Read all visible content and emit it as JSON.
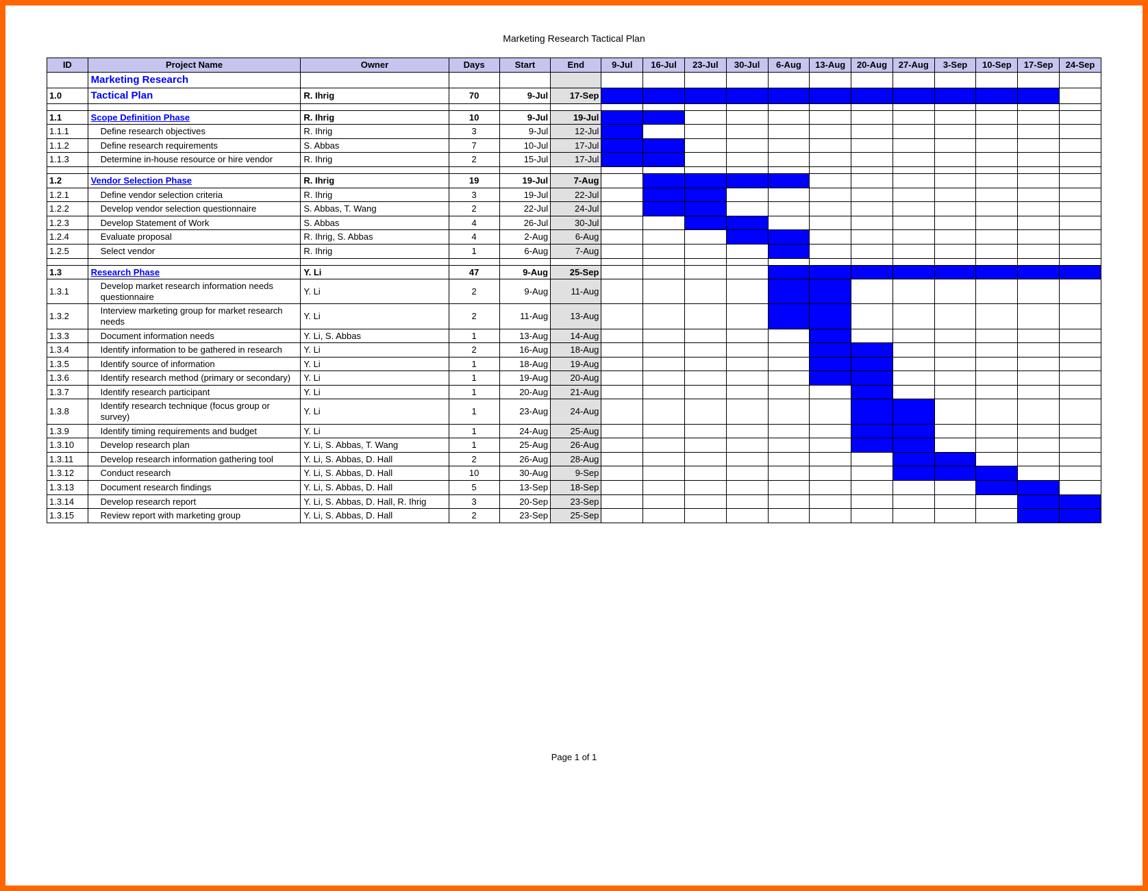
{
  "pageTitle": "Marketing Research Tactical Plan",
  "footer": "Page 1 of 1",
  "headers": {
    "id": "ID",
    "project": "Project Name",
    "owner": "Owner",
    "days": "Days",
    "start": "Start",
    "end": "End",
    "dates": [
      "9-Jul",
      "16-Jul",
      "23-Jul",
      "30-Jul",
      "6-Aug",
      "13-Aug",
      "20-Aug",
      "27-Aug",
      "3-Sep",
      "10-Sep",
      "17-Sep",
      "24-Sep"
    ]
  },
  "rows": [
    {
      "type": "title",
      "id": "",
      "project": "Marketing Research",
      "owner": "",
      "days": "",
      "start": "",
      "end": "",
      "gantt": []
    },
    {
      "type": "title",
      "id": "1.0",
      "project": "Tactical Plan",
      "owner": "R. Ihrig",
      "days": "70",
      "start": "9-Jul",
      "end": "17-Sep",
      "gantt": [
        0,
        1,
        2,
        3,
        4,
        5,
        6,
        7,
        8,
        9,
        10
      ]
    },
    {
      "type": "spacer"
    },
    {
      "type": "phase",
      "id": "1.1",
      "project": "Scope Definition Phase",
      "owner": "R. Ihrig",
      "days": "10",
      "start": "9-Jul",
      "end": "19-Jul",
      "gantt": [
        0,
        1
      ]
    },
    {
      "type": "task",
      "id": "1.1.1",
      "project": "Define research objectives",
      "owner": "R. Ihrig",
      "days": "3",
      "start": "9-Jul",
      "end": "12-Jul",
      "gantt": [
        0
      ]
    },
    {
      "type": "task",
      "id": "1.1.2",
      "project": "Define research requirements",
      "owner": "S. Abbas",
      "days": "7",
      "start": "10-Jul",
      "end": "17-Jul",
      "gantt": [
        0,
        1
      ]
    },
    {
      "type": "task",
      "id": "1.1.3",
      "project": "Determine in-house resource or hire vendor",
      "owner": "R. Ihrig",
      "days": "2",
      "start": "15-Jul",
      "end": "17-Jul",
      "gantt": [
        0,
        1
      ]
    },
    {
      "type": "spacer"
    },
    {
      "type": "phase",
      "id": "1.2",
      "project": "Vendor Selection Phase",
      "owner": "R. Ihrig",
      "days": "19",
      "start": "19-Jul",
      "end": "7-Aug",
      "gantt": [
        1,
        2,
        3,
        4
      ]
    },
    {
      "type": "task",
      "id": "1.2.1",
      "project": "Define vendor selection criteria",
      "owner": "R. Ihrig",
      "days": "3",
      "start": "19-Jul",
      "end": "22-Jul",
      "gantt": [
        1,
        2
      ]
    },
    {
      "type": "task",
      "id": "1.2.2",
      "project": "Develop vendor selection questionnaire",
      "owner": "S. Abbas, T. Wang",
      "days": "2",
      "start": "22-Jul",
      "end": "24-Jul",
      "gantt": [
        1,
        2
      ]
    },
    {
      "type": "task",
      "id": "1.2.3",
      "project": "Develop Statement of Work",
      "owner": "S. Abbas",
      "days": "4",
      "start": "26-Jul",
      "end": "30-Jul",
      "gantt": [
        2,
        3
      ]
    },
    {
      "type": "task",
      "id": "1.2.4",
      "project": "Evaluate proposal",
      "owner": "R. Ihrig, S. Abbas",
      "days": "4",
      "start": "2-Aug",
      "end": "6-Aug",
      "gantt": [
        3,
        4
      ]
    },
    {
      "type": "task",
      "id": "1.2.5",
      "project": "Select vendor",
      "owner": "R. Ihrig",
      "days": "1",
      "start": "6-Aug",
      "end": "7-Aug",
      "gantt": [
        4
      ]
    },
    {
      "type": "spacer"
    },
    {
      "type": "phase",
      "id": "1.3",
      "project": "Research Phase",
      "owner": "Y. Li",
      "days": "47",
      "start": "9-Aug",
      "end": "25-Sep",
      "gantt": [
        4,
        5,
        6,
        7,
        8,
        9,
        10,
        11
      ]
    },
    {
      "type": "task",
      "id": "1.3.1",
      "project": "Develop market research information needs questionnaire",
      "owner": "Y. Li",
      "days": "2",
      "start": "9-Aug",
      "end": "11-Aug",
      "gantt": [
        4,
        5
      ]
    },
    {
      "type": "task",
      "id": "1.3.2",
      "project": "Interview marketing group for market research needs",
      "owner": "Y. Li",
      "days": "2",
      "start": "11-Aug",
      "end": "13-Aug",
      "gantt": [
        4,
        5
      ]
    },
    {
      "type": "task",
      "id": "1.3.3",
      "project": "Document information needs",
      "owner": "Y. Li, S. Abbas",
      "days": "1",
      "start": "13-Aug",
      "end": "14-Aug",
      "gantt": [
        5
      ]
    },
    {
      "type": "task",
      "id": "1.3.4",
      "project": "Identify information to be gathered in research",
      "owner": "Y. Li",
      "days": "2",
      "start": "16-Aug",
      "end": "18-Aug",
      "gantt": [
        5,
        6
      ]
    },
    {
      "type": "task",
      "id": "1.3.5",
      "project": "Identify source of information",
      "owner": "Y. Li",
      "days": "1",
      "start": "18-Aug",
      "end": "19-Aug",
      "gantt": [
        5,
        6
      ]
    },
    {
      "type": "task",
      "id": "1.3.6",
      "project": "Identify research method (primary or secondary)",
      "owner": "Y. Li",
      "days": "1",
      "start": "19-Aug",
      "end": "20-Aug",
      "gantt": [
        5,
        6
      ]
    },
    {
      "type": "task",
      "id": "1.3.7",
      "project": "Identify research participant",
      "owner": "Y. Li",
      "days": "1",
      "start": "20-Aug",
      "end": "21-Aug",
      "gantt": [
        6
      ]
    },
    {
      "type": "task",
      "id": "1.3.8",
      "project": "Identify research technique (focus group or survey)",
      "owner": "Y. Li",
      "days": "1",
      "start": "23-Aug",
      "end": "24-Aug",
      "gantt": [
        6,
        7
      ]
    },
    {
      "type": "task",
      "id": "1.3.9",
      "project": "Identify timing requirements and budget",
      "owner": "Y. Li",
      "days": "1",
      "start": "24-Aug",
      "end": "25-Aug",
      "gantt": [
        6,
        7
      ]
    },
    {
      "type": "task",
      "id": "1.3.10",
      "project": "Develop research plan",
      "owner": "Y. Li, S. Abbas, T. Wang",
      "days": "1",
      "start": "25-Aug",
      "end": "26-Aug",
      "gantt": [
        6,
        7
      ]
    },
    {
      "type": "task",
      "id": "1.3.11",
      "project": "Develop research information gathering tool",
      "owner": "Y. Li, S. Abbas, D. Hall",
      "days": "2",
      "start": "26-Aug",
      "end": "28-Aug",
      "gantt": [
        7,
        8
      ]
    },
    {
      "type": "task",
      "id": "1.3.12",
      "project": "Conduct research",
      "owner": "Y. Li, S. Abbas, D. Hall",
      "days": "10",
      "start": "30-Aug",
      "end": "9-Sep",
      "gantt": [
        7,
        8,
        9
      ]
    },
    {
      "type": "task",
      "id": "1.3.13",
      "project": "Document research findings",
      "owner": "Y. Li, S. Abbas, D. Hall",
      "days": "5",
      "start": "13-Sep",
      "end": "18-Sep",
      "gantt": [
        9,
        10
      ]
    },
    {
      "type": "task",
      "id": "1.3.14",
      "project": "Develop research report",
      "owner": "Y. Li, S. Abbas, D. Hall, R. Ihrig",
      "days": "3",
      "start": "20-Sep",
      "end": "23-Sep",
      "gantt": [
        10,
        11
      ]
    },
    {
      "type": "task",
      "id": "1.3.15",
      "project": "Review report with marketing group",
      "owner": "Y. Li, S. Abbas, D. Hall",
      "days": "2",
      "start": "23-Sep",
      "end": "25-Sep",
      "gantt": [
        10,
        11
      ]
    }
  ]
}
